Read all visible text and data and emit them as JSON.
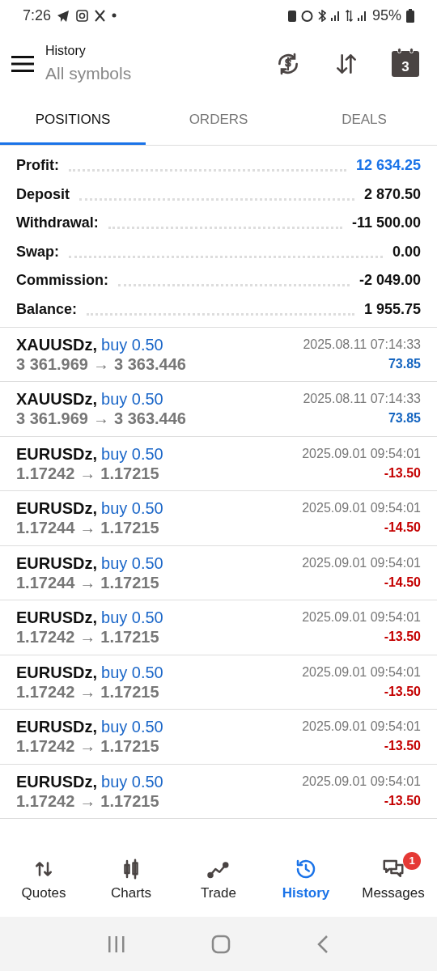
{
  "status_bar": {
    "time": "7:26",
    "battery": "95%"
  },
  "header": {
    "title": "History",
    "subtitle": "All symbols",
    "calendar_day": "3"
  },
  "tabs": [
    {
      "label": "POSITIONS",
      "selected": true
    },
    {
      "label": "ORDERS",
      "selected": false
    },
    {
      "label": "DEALS",
      "selected": false
    }
  ],
  "summary": [
    {
      "label": "Profit:",
      "value": "12 634.25",
      "highlight": true
    },
    {
      "label": "Deposit",
      "value": "2 870.50",
      "highlight": false
    },
    {
      "label": "Withdrawal:",
      "value": "-11 500.00",
      "highlight": false
    },
    {
      "label": "Swap:",
      "value": "0.00",
      "highlight": false
    },
    {
      "label": "Commission:",
      "value": "-2 049.00",
      "highlight": false
    },
    {
      "label": "Balance:",
      "value": "1 955.75",
      "highlight": false
    }
  ],
  "deals": [
    {
      "symbol": "XAUUSDz,",
      "side": "buy 0.50",
      "open": "3 361.969",
      "arrow": "→",
      "close": "3 363.446",
      "time": "2025.08.11 07:14:33",
      "profit": "73.85",
      "color": "#1565c0"
    },
    {
      "symbol": "XAUUSDz,",
      "side": "buy 0.50",
      "open": "3 361.969",
      "arrow": "→",
      "close": "3 363.446",
      "time": "2025.08.11 07:14:33",
      "profit": "73.85",
      "color": "#1565c0"
    },
    {
      "symbol": "EURUSDz,",
      "side": "buy 0.50",
      "open": "1.17242",
      "arrow": "→",
      "close": "1.17215",
      "time": "2025.09.01 09:54:01",
      "profit": "-13.50",
      "color": "#c40000"
    },
    {
      "symbol": "EURUSDz,",
      "side": "buy 0.50",
      "open": "1.17244",
      "arrow": "→",
      "close": "1.17215",
      "time": "2025.09.01 09:54:01",
      "profit": "-14.50",
      "color": "#c40000"
    },
    {
      "symbol": "EURUSDz,",
      "side": "buy 0.50",
      "open": "1.17244",
      "arrow": "→",
      "close": "1.17215",
      "time": "2025.09.01 09:54:01",
      "profit": "-14.50",
      "color": "#c40000"
    },
    {
      "symbol": "EURUSDz,",
      "side": "buy 0.50",
      "open": "1.17242",
      "arrow": "→",
      "close": "1.17215",
      "time": "2025.09.01 09:54:01",
      "profit": "-13.50",
      "color": "#c40000"
    },
    {
      "symbol": "EURUSDz,",
      "side": "buy 0.50",
      "open": "1.17242",
      "arrow": "→",
      "close": "1.17215",
      "time": "2025.09.01 09:54:01",
      "profit": "-13.50",
      "color": "#c40000"
    },
    {
      "symbol": "EURUSDz,",
      "side": "buy 0.50",
      "open": "1.17242",
      "arrow": "→",
      "close": "1.17215",
      "time": "2025.09.01 09:54:01",
      "profit": "-13.50",
      "color": "#c40000"
    },
    {
      "symbol": "EURUSDz,",
      "side": "buy 0.50",
      "open": "1.17242",
      "arrow": "→",
      "close": "1.17215",
      "time": "2025.09.01 09:54:01",
      "profit": "-13.50",
      "color": "#c40000"
    }
  ],
  "bottom_nav": [
    {
      "kind": "quotes",
      "label": "Quotes",
      "selected": false
    },
    {
      "kind": "charts",
      "label": "Charts",
      "selected": false
    },
    {
      "kind": "trade",
      "label": "Trade",
      "selected": false
    },
    {
      "kind": "history",
      "label": "History",
      "selected": true
    },
    {
      "kind": "messages",
      "label": "Messages",
      "selected": false,
      "badge": "1"
    }
  ]
}
